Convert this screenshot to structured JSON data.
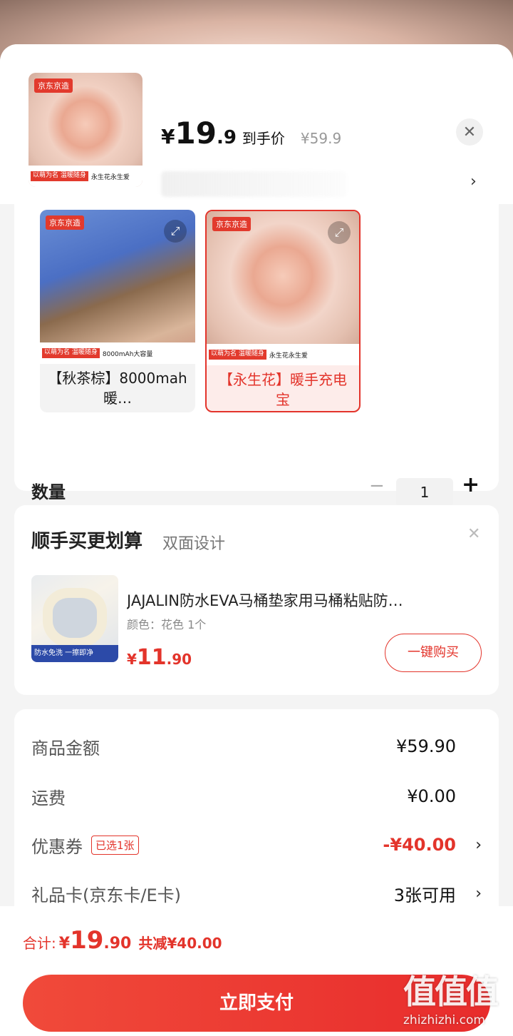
{
  "product": {
    "thumb_brand": "京东京造",
    "thumb_tag": "以萌为名 温暖随身",
    "thumb_slogan": "永生花永生爱",
    "price_symbol": "¥",
    "price_int": "19",
    "price_dec": ".9",
    "price_label": "到手价",
    "original_price": "¥59.9"
  },
  "options": [
    {
      "brand": "京东京造",
      "tag": "以萌为名 温暖随身",
      "band_text": "8000mAh大容量",
      "name": "【秋茶棕】8000mah暖…",
      "selected": false
    },
    {
      "brand": "京东京造",
      "tag": "以萌为名 温暖随身",
      "band_text": "永生花永生爱",
      "name": "【永生花】暖手充电宝",
      "selected": true
    }
  ],
  "quantity": {
    "label": "数量",
    "value": "1",
    "minus": "−",
    "plus": "+"
  },
  "upsell": {
    "title": "顺手买更划算",
    "subtitle": "双面设计",
    "img_band": "防水免洗 一擦即净",
    "name": "JAJALIN防水EVA马桶垫家用马桶粘贴防…",
    "spec": "颜色：花色 1个",
    "price_symbol": "¥",
    "price_int": "11",
    "price_dec": ".90",
    "buy_label": "一键购买"
  },
  "summary": {
    "goods_label": "商品金额",
    "goods_value": "¥59.90",
    "shipping_label": "运费",
    "shipping_value": "¥0.00",
    "coupon_label": "优惠券",
    "coupon_badge": "已选1张",
    "coupon_value": "-¥40.00",
    "giftcard_label": "礼品卡(京东卡/E卡)",
    "giftcard_value": "3张可用"
  },
  "footer": {
    "total_label": "合计:",
    "total_symbol": "¥",
    "total_int": "19",
    "total_dec": ".90",
    "total_saved": "共减¥40.00",
    "pay_label": "立即支付"
  },
  "watermark": {
    "big": "值值值",
    "small": "zhizhizhi.com"
  },
  "colors": {
    "accent": "#e3342b",
    "pay_button": "#ee3b34"
  }
}
